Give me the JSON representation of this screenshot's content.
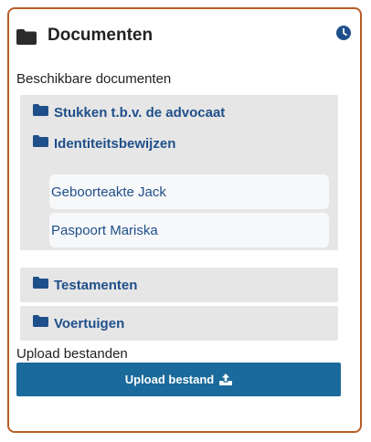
{
  "card": {
    "title": "Documenten",
    "title_icon": "folder-icon",
    "status_icon": "clock-icon"
  },
  "available": {
    "label": "Beschikbare documenten",
    "folders": [
      {
        "label": "Stukken t.b.v. de advocaat",
        "expanded": false
      },
      {
        "label": "Identiteitsbewijzen",
        "expanded": true,
        "documents": [
          "Geboorteakte Jack",
          "Paspoort Mariska"
        ]
      },
      {
        "label": "Testamenten",
        "expanded": false
      },
      {
        "label": "Voertuigen",
        "expanded": false
      }
    ]
  },
  "upload": {
    "label": "Upload bestanden",
    "button_label": "Upload bestand",
    "button_icon": "upload-icon"
  },
  "colors": {
    "border": "#b85c25",
    "folder_bg": "#e6e6e6",
    "link": "#1f4f8a",
    "button": "#1a6a9b"
  }
}
